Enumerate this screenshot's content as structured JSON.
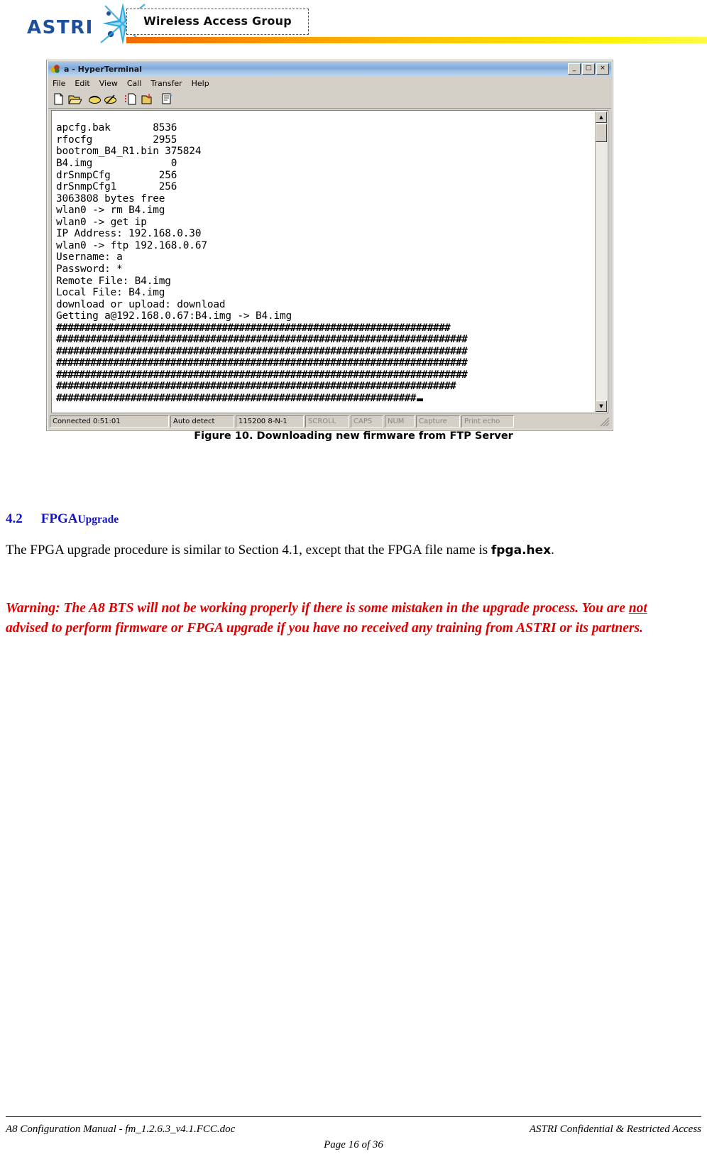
{
  "header": {
    "logo_text": "ASTRI",
    "logo_icon": "star-burst-logo",
    "group_title": "Wireless Access Group",
    "bar_gradient_from": "#f06a00",
    "bar_gradient_to": "#fff200"
  },
  "terminal": {
    "title": "a - HyperTerminal",
    "window_icon": "hyperterminal-icon",
    "window_buttons": {
      "minimize": "_",
      "maximize": "□",
      "close": "×"
    },
    "menu": [
      "File",
      "Edit",
      "View",
      "Call",
      "Transfer",
      "Help"
    ],
    "toolbar_icons": [
      "new-connection-icon",
      "open-icon",
      "call-icon",
      "disconnect-icon",
      "send-file-icon",
      "receive-file-icon",
      "properties-icon"
    ],
    "lines": [
      "apcfg.bak       8536",
      "rfocfg          2955",
      "bootrom_B4_R1.bin 375824",
      "B4.img             0",
      "drSnmpCfg        256",
      "drSnmpCfg1       256",
      "3063808 bytes free",
      "wlan0 -> rm B4.img",
      "wlan0 -> get ip",
      "IP Address: 192.168.0.30",
      "wlan0 -> ftp 192.168.0.67",
      "Username: a",
      "Password: *",
      "Remote File: B4.img",
      "Local File: B4.img",
      "download or upload: download",
      "Getting a@192.168.0.67:B4.img -> B4.img"
    ],
    "hash_lines": [
      "#####################################################################",
      "########################################################################",
      "########################################################################",
      "########################################################################",
      "########################################################################",
      "######################################################################",
      "###############################################################"
    ],
    "scrollbar": {
      "up_arrow": "▲",
      "down_arrow": "▼"
    },
    "status": {
      "connected": "Connected 0:51:01",
      "detect": "Auto detect",
      "settings": "115200 8-N-1",
      "scroll": "SCROLL",
      "caps": "CAPS",
      "num": "NUM",
      "capture": "Capture",
      "print_echo": "Print echo"
    }
  },
  "document": {
    "figure_caption": "Figure 10. Downloading new firmware from FTP Server",
    "section": {
      "number": "4.2",
      "title_main": "FPGA",
      "title_smallcaps": "Upgrade",
      "color": "#1414c8"
    },
    "paragraph_prefix": "The FPGA upgrade procedure is similar to Section 4.1, except that the FPGA file name is ",
    "paragraph_filename": "fpga.hex",
    "paragraph_suffix": ".",
    "warning": {
      "part1": "Warning: The A8 BTS will not be working properly if there is some mistaken in the upgrade process. You are ",
      "emphasis": "not",
      "part2": " advised to perform firmware or FPGA upgrade if you have no received any training from ASTRI or its partners.",
      "color": "#e00000"
    }
  },
  "footer": {
    "left": "A8 Configuration Manual - fm_1.2.6.3_v4.1.FCC.doc",
    "right": "ASTRI Confidential & Restricted Access",
    "page": "Page 16 of 36"
  }
}
